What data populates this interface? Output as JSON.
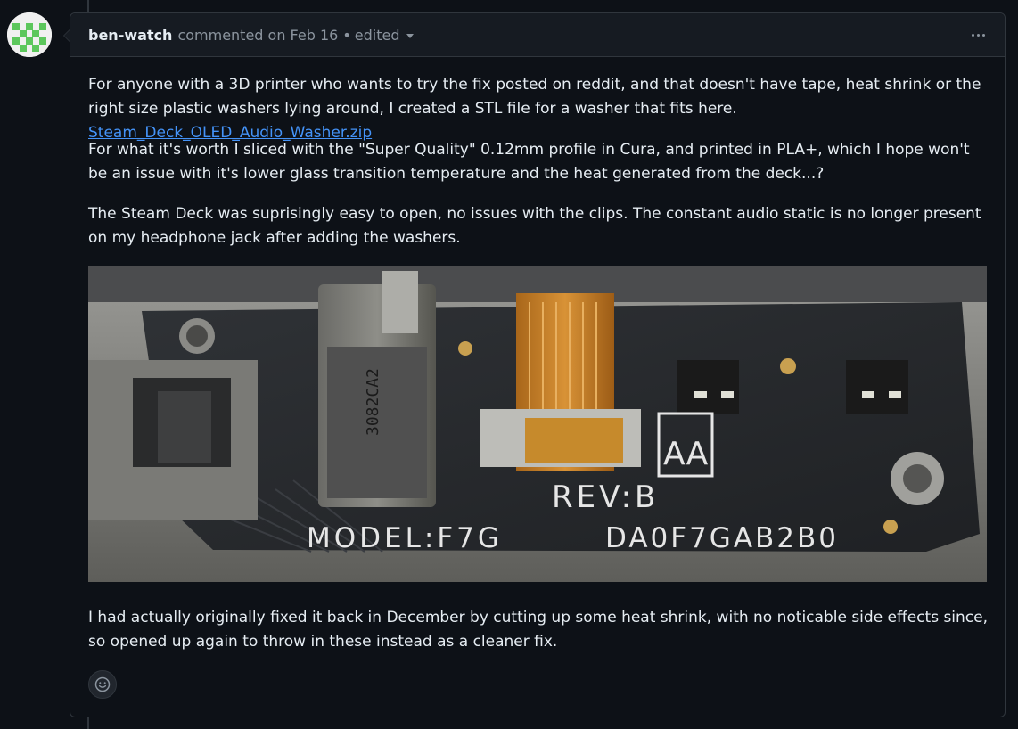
{
  "comment": {
    "author": "ben-watch",
    "action": "commented on Feb 16",
    "separator": "•",
    "edited_label": "edited",
    "paragraph1_text": "For anyone with a 3D printer who wants to try the fix posted on reddit, and that doesn't have tape, heat shrink or the right size plastic washers lying around, I created a STL file for a washer that fits here. ",
    "paragraph1_link": "Steam_Deck_OLED_Audio_Washer.zip",
    "paragraph2": "For what it's worth I sliced with the \"Super Quality\" 0.12mm profile in Cura, and printed in PLA+, which I hope won't be an issue with it's lower glass transition temperature and the heat generated from the deck...?",
    "paragraph3": "The Steam Deck was suprisingly easy to open, no issues with the clips. The constant audio static is no longer present on my headphone jack after adding the washers.",
    "paragraph4": "I had actually originally fixed it back in December by cutting up some heat shrink, with no noticable side effects since, so opened up again to throw in these instead as a cleaner fix.",
    "photo": {
      "label_aa": "AA",
      "label_rev": "REV:B",
      "label_model": "MODEL:F7G",
      "label_part": "DA0F7GAB2B0",
      "label_chip": "3082CA2"
    }
  },
  "icons": {
    "menu": "kebab-horizontal-icon",
    "reaction": "smiley-icon",
    "dropdown": "triangle-down-icon"
  },
  "colors": {
    "background": "#0d1117",
    "header": "#161b22",
    "border": "#30363d",
    "link": "#4493f8",
    "muted": "#8b949e"
  }
}
